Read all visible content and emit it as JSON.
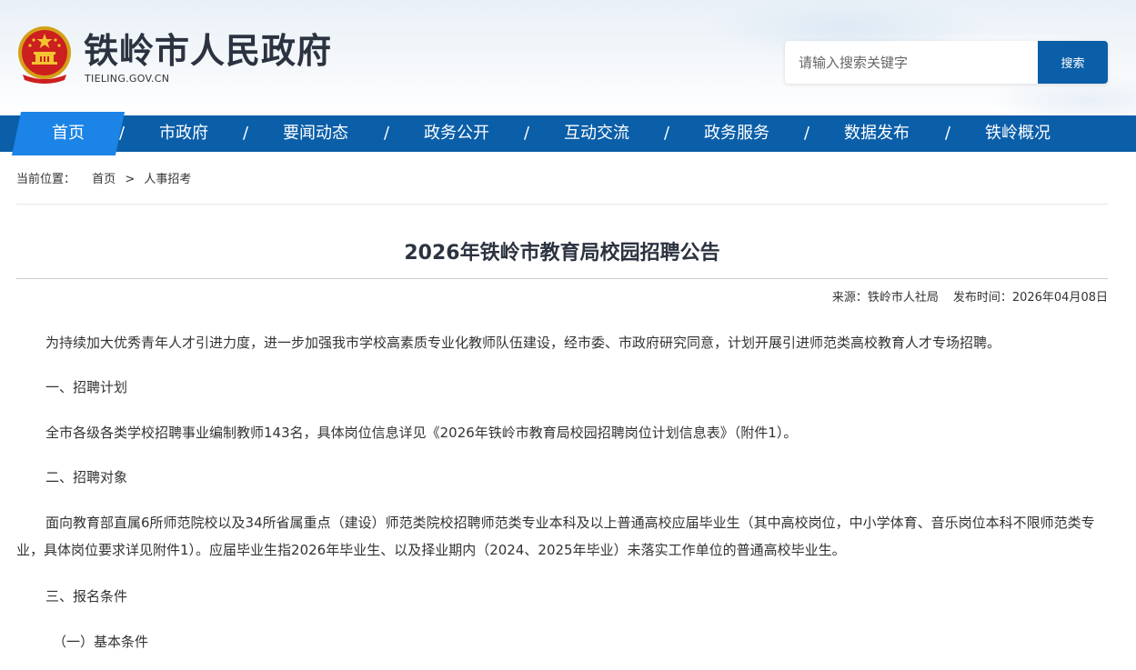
{
  "header": {
    "site_title": "铁岭市人民政府",
    "site_domain": "TIELING.GOV.CN",
    "emblem_icon": "national-emblem-icon"
  },
  "search": {
    "placeholder": "请输入搜索关键字",
    "button_label": "搜索"
  },
  "nav": {
    "items": [
      {
        "label": "首页",
        "active": true
      },
      {
        "label": "市政府"
      },
      {
        "label": "要闻动态"
      },
      {
        "label": "政务公开"
      },
      {
        "label": "互动交流"
      },
      {
        "label": "政务服务"
      },
      {
        "label": "数据发布"
      },
      {
        "label": "铁岭概况"
      }
    ],
    "separator": "/"
  },
  "breadcrumb": {
    "label": "当前位置：",
    "items": [
      "首页",
      "人事招考"
    ],
    "arrow": ">"
  },
  "article": {
    "title": "2026年铁岭市教育局校园招聘公告",
    "source": "来源：铁岭市人社局",
    "publish_time": "发布时间：2026年04月08日",
    "paragraphs": [
      "为持续加大优秀青年人才引进力度，进一步加强我市学校高素质专业化教师队伍建设，经市委、市政府研究同意，计划开展引进师范类高校教育人才专场招聘。",
      "一、招聘计划",
      "全市各级各类学校招聘事业编制教师143名，具体岗位信息详见《2026年铁岭市教育局校园招聘岗位计划信息表》（附件1）。",
      "二、招聘对象",
      "面向教育部直属6所师范院校以及34所省属重点（建设）师范类院校招聘师范类专业本科及以上普通高校应届毕业生（其中高校岗位，中小学体育、音乐岗位本科不限师范类专业，具体岗位要求详见附件1）。应届毕业生指2026年毕业生、以及择业期内（2024、2025年毕业）未落实工作单位的普通高校毕业生。",
      "三、报名条件",
      "（一）基本条件"
    ]
  },
  "colors": {
    "nav_bg": "#0b5ea8",
    "nav_active": "#1c84e6",
    "title_text": "#2c3340"
  }
}
